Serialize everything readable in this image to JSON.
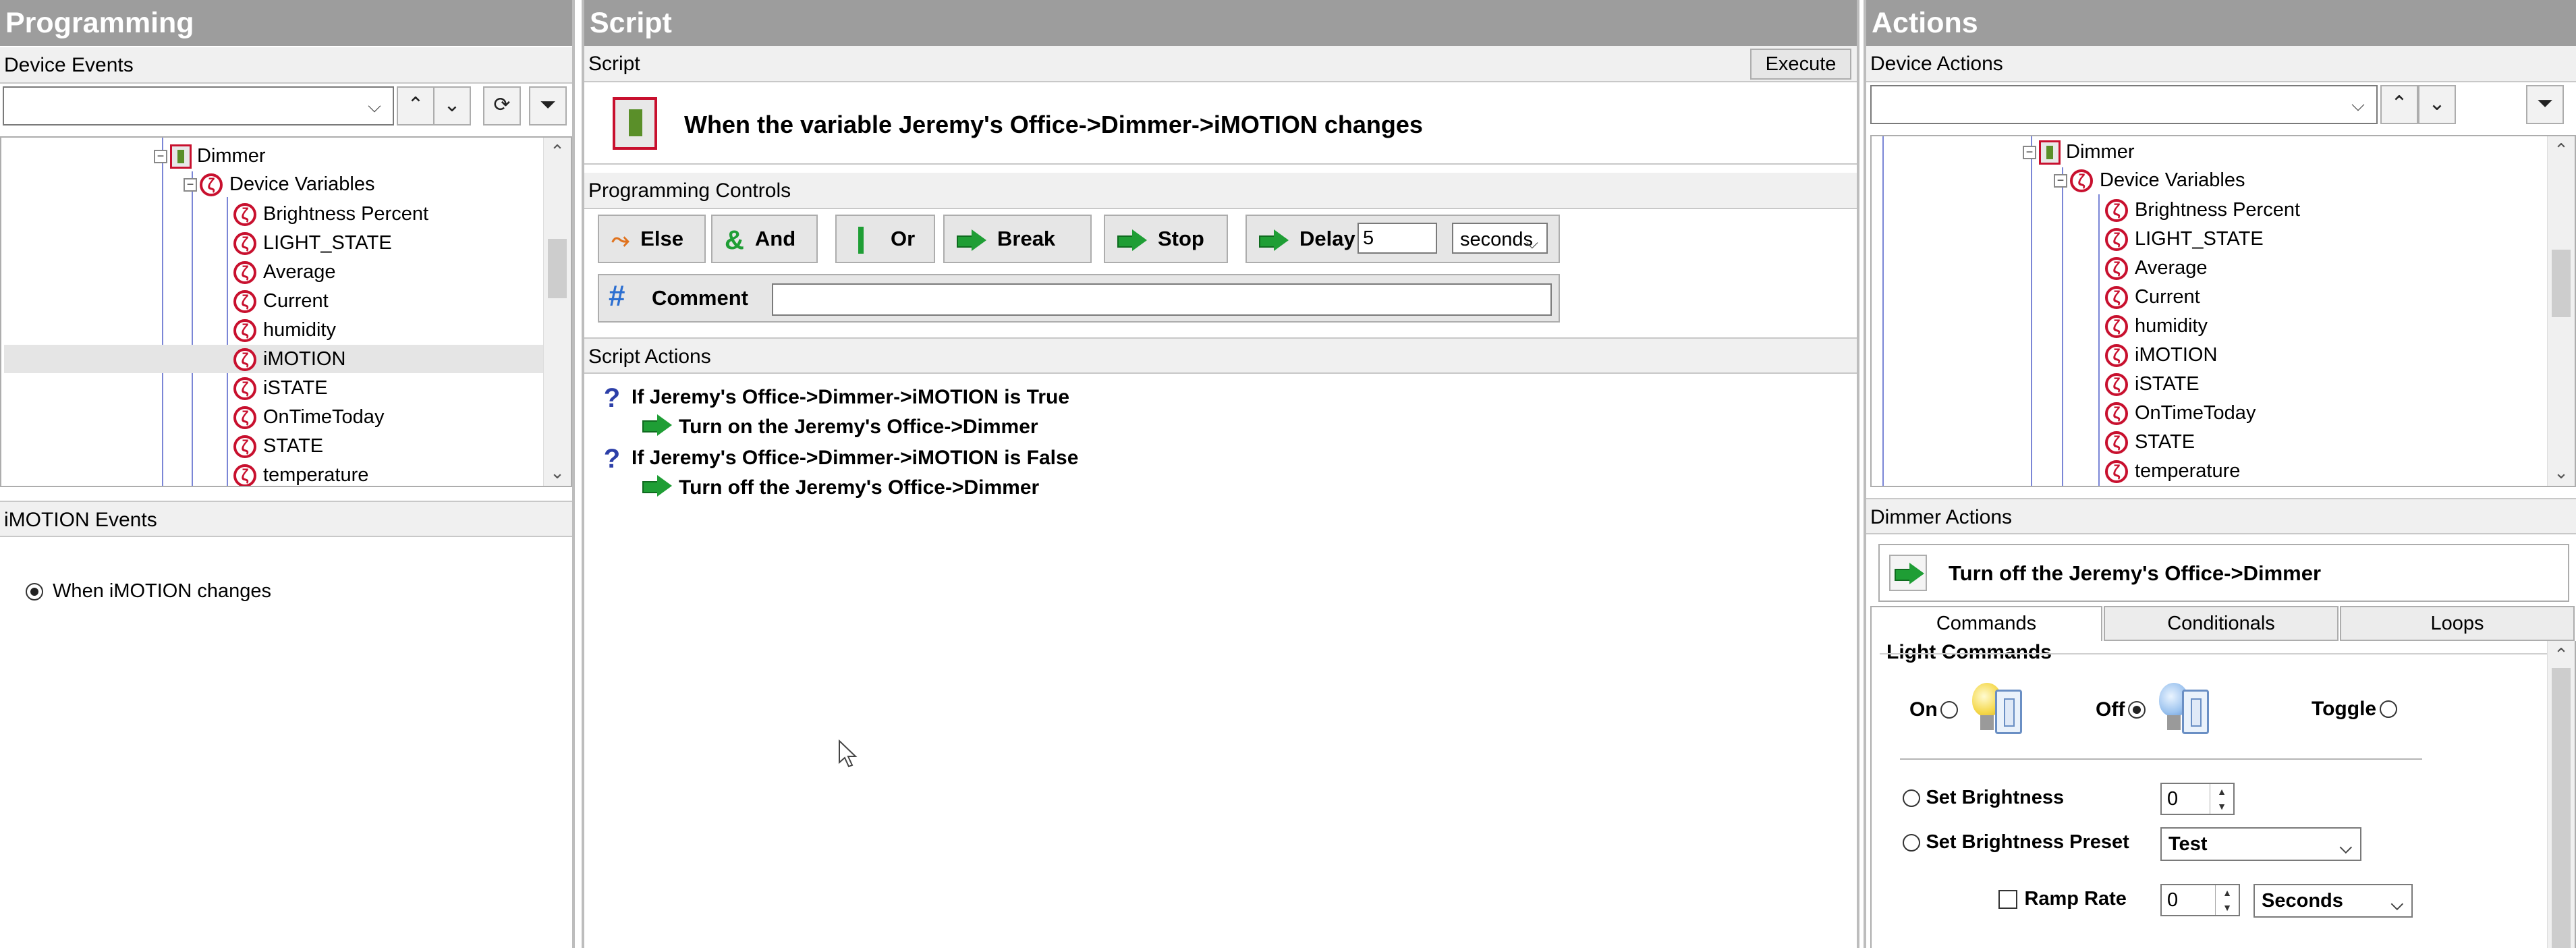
{
  "programming": {
    "header": "Programming",
    "device_events_label": "Device Events",
    "tree": {
      "device": "Dimmer",
      "group": "Device Variables",
      "variables": [
        "Brightness Percent",
        "LIGHT_STATE",
        "Average",
        "Current",
        "humidity",
        "iMOTION",
        "iSTATE",
        "OnTimeToday",
        "STATE",
        "temperature"
      ],
      "selected": "iMOTION"
    },
    "events_label": "iMOTION Events",
    "event_option": "When iMOTION changes"
  },
  "script": {
    "header": "Script",
    "script_label": "Script",
    "execute_label": "Execute",
    "title": "When the variable Jeremy's Office->Dimmer->iMOTION changes",
    "controls_label": "Programming Controls",
    "buttons": {
      "else": "Else",
      "and": "And",
      "or": "Or",
      "break": "Break",
      "stop": "Stop",
      "delay": "Delay",
      "comment": "Comment"
    },
    "delay_value": "5",
    "delay_unit": "seconds",
    "comment_value": "",
    "actions_label": "Script Actions",
    "actions": [
      {
        "type": "if",
        "text": "If Jeremy's Office->Dimmer->iMOTION is True"
      },
      {
        "type": "action",
        "text": "Turn on the Jeremy's Office->Dimmer"
      },
      {
        "type": "if",
        "text": "If Jeremy's Office->Dimmer->iMOTION is False"
      },
      {
        "type": "action",
        "text": "Turn off the Jeremy's Office->Dimmer"
      }
    ]
  },
  "actions": {
    "header": "Actions",
    "device_actions_label": "Device Actions",
    "tree": {
      "device": "Dimmer",
      "group": "Device Variables",
      "variables": [
        "Brightness Percent",
        "LIGHT_STATE",
        "Average",
        "Current",
        "humidity",
        "iMOTION",
        "iSTATE",
        "OnTimeToday",
        "STATE",
        "temperature"
      ]
    },
    "dimmer_actions_label": "Dimmer Actions",
    "current_action": "Turn off the Jeremy's Office->Dimmer",
    "tabs": [
      "Commands",
      "Conditionals",
      "Loops"
    ],
    "active_tab": "Commands",
    "light_commands_label": "Light Commands",
    "on_label": "On",
    "off_label": "Off",
    "toggle_label": "Toggle",
    "selected_command": "Off",
    "set_brightness_label": "Set Brightness",
    "set_brightness_value": "0",
    "set_brightness_preset_label": "Set Brightness Preset",
    "preset_value": "Test",
    "ramp_rate_label": "Ramp Rate",
    "ramp_rate_value": "0",
    "ramp_rate_unit": "Seconds"
  }
}
